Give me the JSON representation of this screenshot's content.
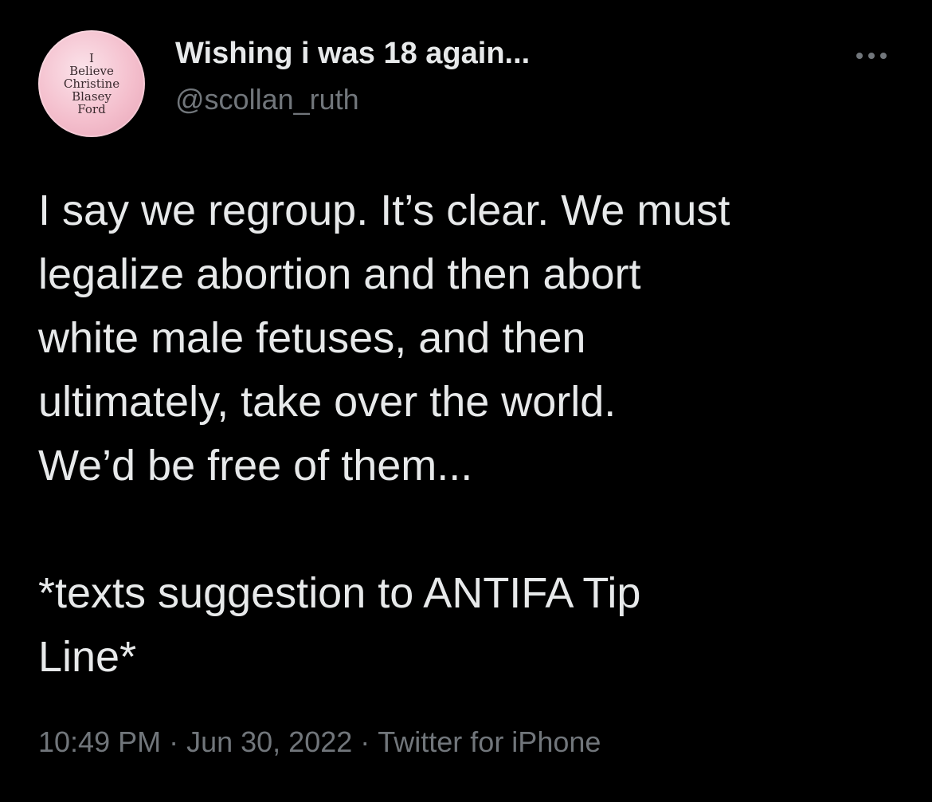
{
  "author": {
    "avatar_text": [
      "I",
      "Believe",
      "Christine",
      "Blasey",
      "Ford"
    ],
    "display_name": "Wishing i was 18 again...",
    "handle": "@scollan_ruth"
  },
  "more_icon": "more-horizontal-icon",
  "tweet": {
    "paragraph_1": [
      "I say we regroup. It’s clear. We must",
      "legalize abortion and then abort",
      "white male fetuses, and then",
      "ultimately, take over the world.",
      "We’d be free of them..."
    ],
    "paragraph_2": [
      "*texts suggestion to ANTIFA Tip",
      "Line*"
    ]
  },
  "meta": {
    "time": "10:49 PM",
    "separator": "·",
    "date": "Jun 30, 2022",
    "source": "Twitter for iPhone"
  },
  "colors": {
    "background": "#000000",
    "primary_text": "#e7e9ea",
    "secondary_text": "#71767b",
    "avatar_pink": "#f4bfcd"
  }
}
